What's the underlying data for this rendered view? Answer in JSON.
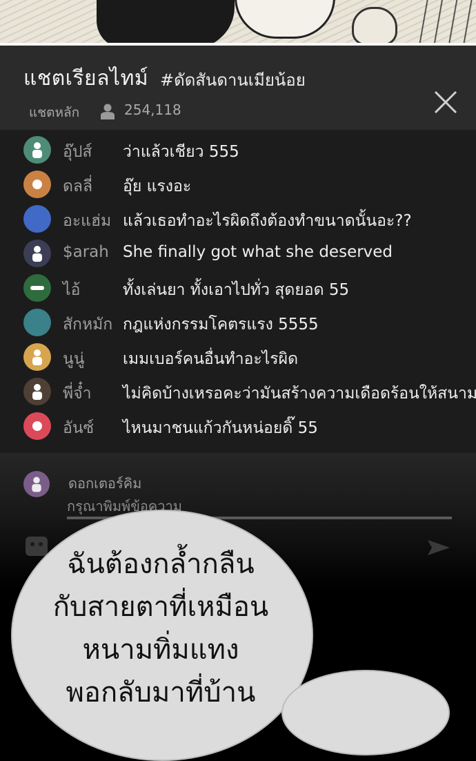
{
  "header": {
    "title": "แชตเรียลไทม์",
    "hashtag": "#ดัดสันดานเมียน้อย",
    "channel": "แชตหลัก",
    "viewer_count": "254,118"
  },
  "messages": [
    {
      "user": "อุ๊ปส์",
      "text": "ว่าแล้วเชียว 555",
      "avatar_color": "#4e8c77",
      "avatar_icon": "person-icon"
    },
    {
      "user": "ดลลี่",
      "text": "อุ๊ย แรงอะ",
      "avatar_color": "#c98244",
      "avatar_icon": "dot-icon"
    },
    {
      "user": "อะแฮ่ม",
      "text": "แล้วเธอทำอะไรผิดถึงต้องทำขนาดนั้นอะ??",
      "avatar_color": "#4169c6",
      "avatar_icon": "none"
    },
    {
      "user": "$arah",
      "text": "She finally got what she deserved",
      "avatar_color": "#3c3e55",
      "avatar_icon": "person-icon"
    },
    {
      "user": "ไอ้",
      "text": "ทั้งเล่นยา ทั้งเอาไปทั่ว สุดยอด 55",
      "avatar_color": "#2e6c3e",
      "avatar_icon": "minus-icon"
    },
    {
      "user": "สักหมัก",
      "text": "กฎแห่งกรรมโคตรแรง 5555",
      "avatar_color": "#3a8189",
      "avatar_icon": "none"
    },
    {
      "user": "นูนู่",
      "text": "เมมเบอร์คนอื่นทำอะไรผิด",
      "avatar_color": "#d7a54e",
      "avatar_icon": "person-icon"
    },
    {
      "user": "พี่จ๋ำ",
      "text": "ไม่คิดบ้างเหรอคะว่ามันสร้างความเดือดร้อนให้สนามบิน?",
      "avatar_color": "#4f4035",
      "avatar_icon": "person-icon"
    },
    {
      "user": "อันซ์",
      "text": "ไหนมาชนแก้วกันหน่อยดิ๊ 55",
      "avatar_color": "#dc4a5a",
      "avatar_icon": "dot-icon"
    }
  ],
  "input": {
    "current_user": "ดอกเตอร์คิม",
    "placeholder": "กรุณาพิมพ์ข้อความ"
  },
  "bubble": {
    "lines": [
      "ฉันต้องกล้ำกลืน",
      "กับสายตาที่เหมือน",
      "หนามทิ่มแทง",
      "พอกลับมาที่บ้าน"
    ]
  }
}
